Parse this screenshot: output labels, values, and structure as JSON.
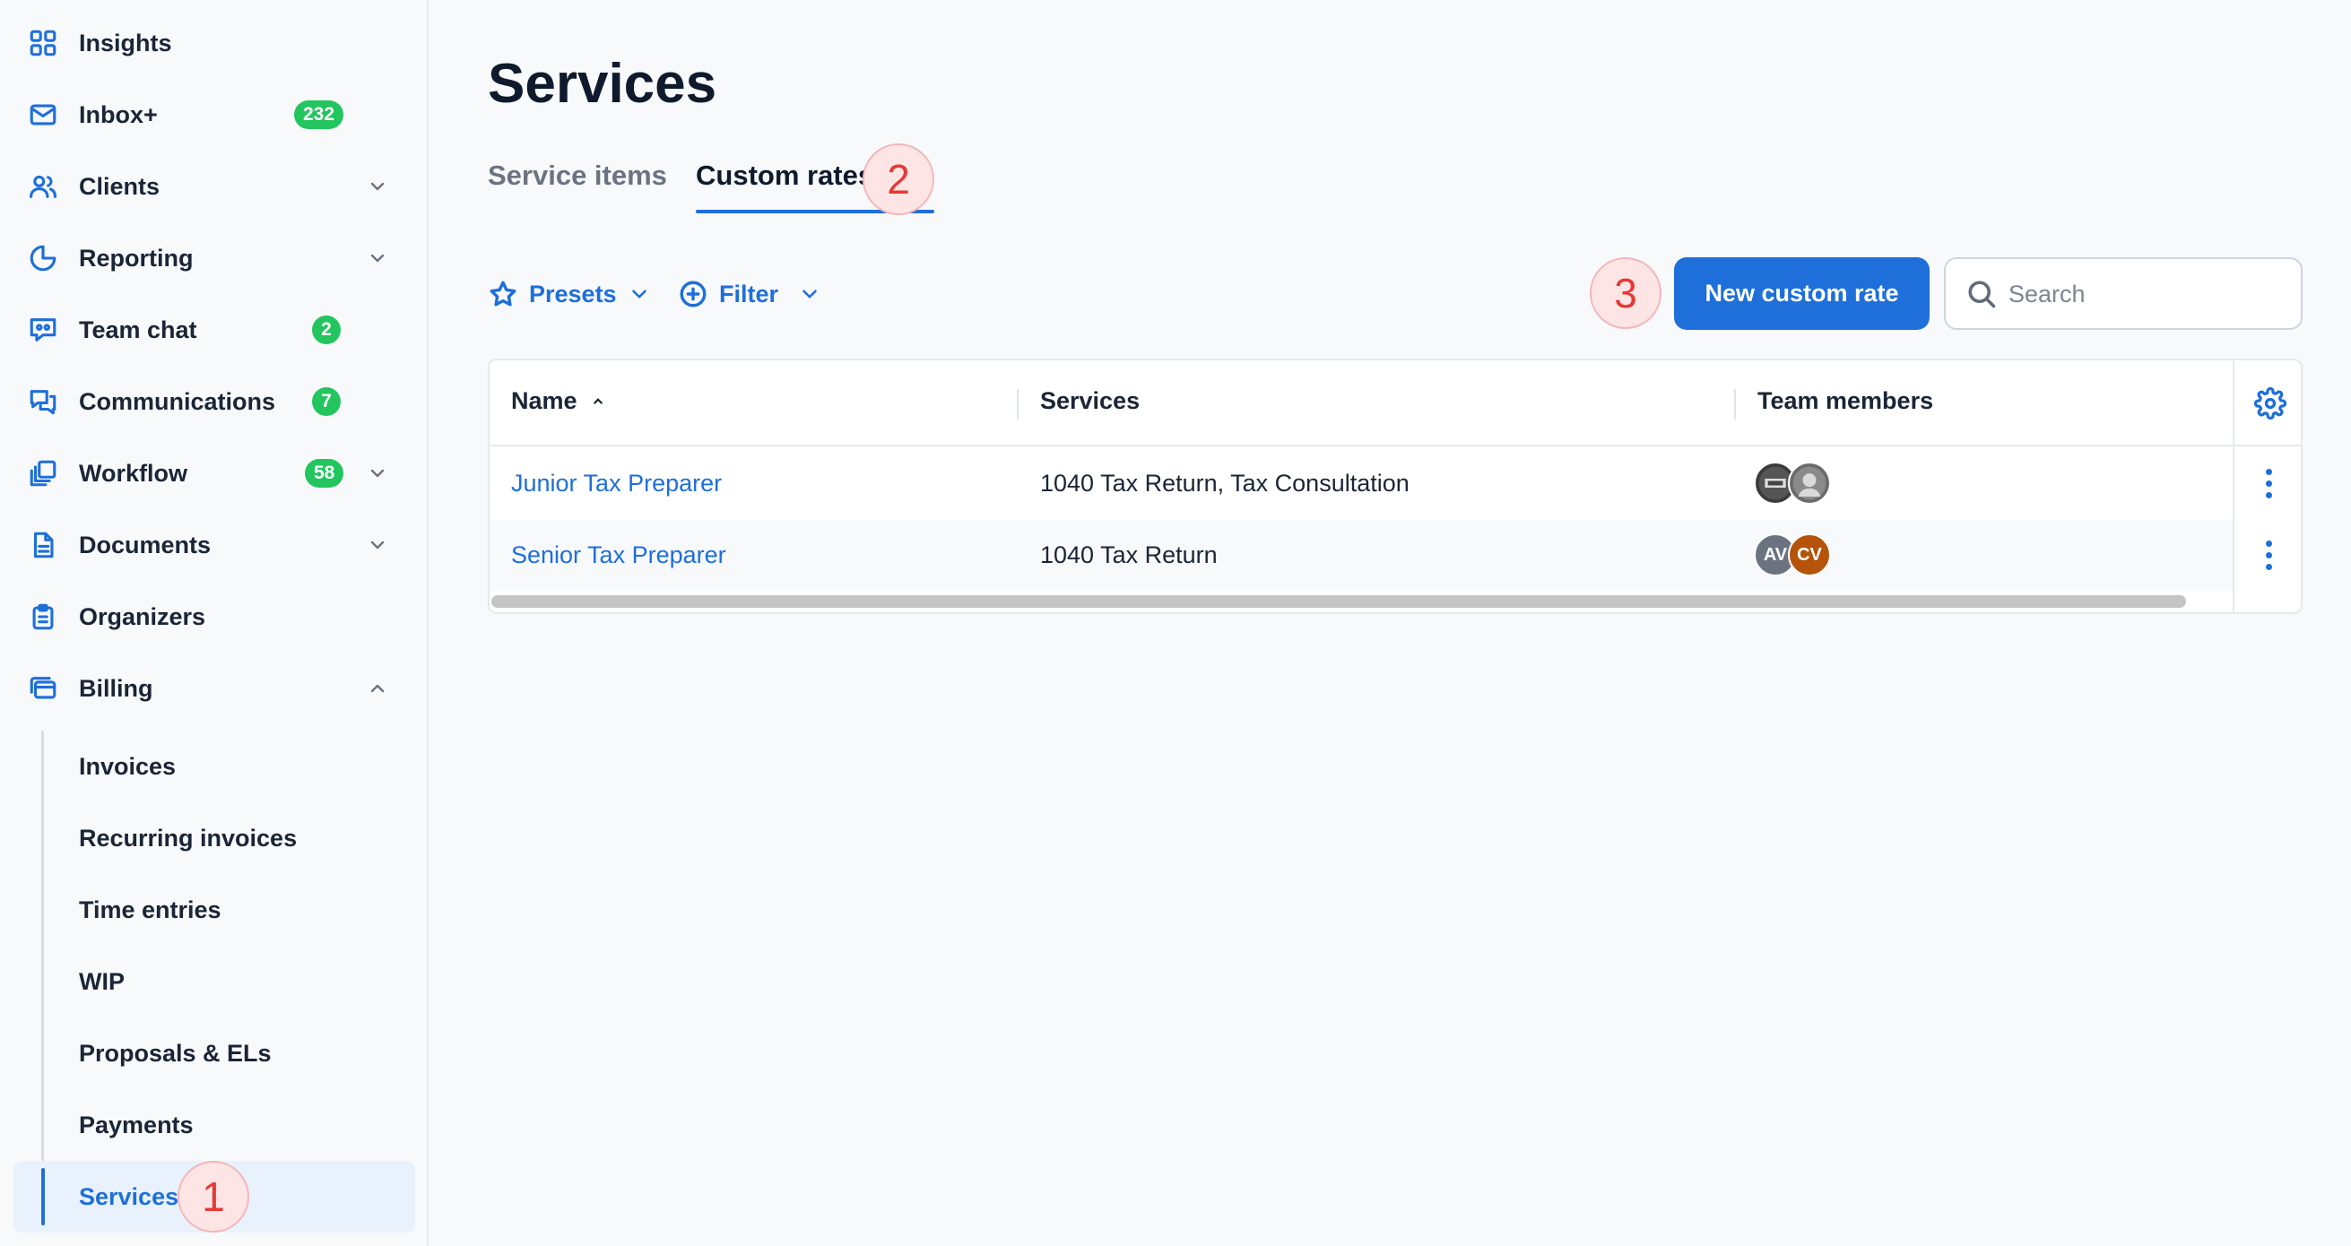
{
  "sidebar": {
    "items": [
      {
        "label": "Insights",
        "icon": "grid-icon"
      },
      {
        "label": "Inbox+",
        "icon": "mail-icon",
        "badge": "232"
      },
      {
        "label": "Clients",
        "icon": "users-icon",
        "chevron": "down"
      },
      {
        "label": "Reporting",
        "icon": "pie-chart-icon",
        "chevron": "down"
      },
      {
        "label": "Team chat",
        "icon": "team-chat-icon",
        "badge": "2"
      },
      {
        "label": "Communications",
        "icon": "chat-bubbles-icon",
        "badge": "7"
      },
      {
        "label": "Workflow",
        "icon": "workflow-icon",
        "badge": "58",
        "chevron": "down"
      },
      {
        "label": "Documents",
        "icon": "document-icon",
        "chevron": "down"
      },
      {
        "label": "Organizers",
        "icon": "clipboard-icon"
      },
      {
        "label": "Billing",
        "icon": "billing-icon",
        "chevron": "up"
      }
    ],
    "billing_sub": [
      "Invoices",
      "Recurring invoices",
      "Time entries",
      "WIP",
      "Proposals & ELs",
      "Payments",
      "Services"
    ],
    "active_sub": "Services"
  },
  "page": {
    "title": "Services"
  },
  "tabs": [
    {
      "label": "Service items",
      "active": false
    },
    {
      "label": "Custom rates",
      "active": true
    }
  ],
  "toolbar": {
    "presets_label": "Presets",
    "filter_label": "Filter",
    "new_button": "New custom rate",
    "search_placeholder": "Search"
  },
  "steps": [
    "1",
    "2",
    "3"
  ],
  "table": {
    "columns": [
      "Name",
      "Services",
      "Team members"
    ],
    "rows": [
      {
        "name": "Junior Tax Preparer",
        "services": "1040 Tax Return, Tax Consultation",
        "members": [
          "photo",
          "photo"
        ]
      },
      {
        "name": "Senior Tax Preparer",
        "services": "1040 Tax Return",
        "members": [
          "AV",
          "CV"
        ]
      }
    ]
  },
  "colors": {
    "accent": "#1e6fd9",
    "badge": "#22c55e",
    "step": "#e53935",
    "avatar_av": "#6b7280",
    "avatar_cv": "#b45309"
  }
}
